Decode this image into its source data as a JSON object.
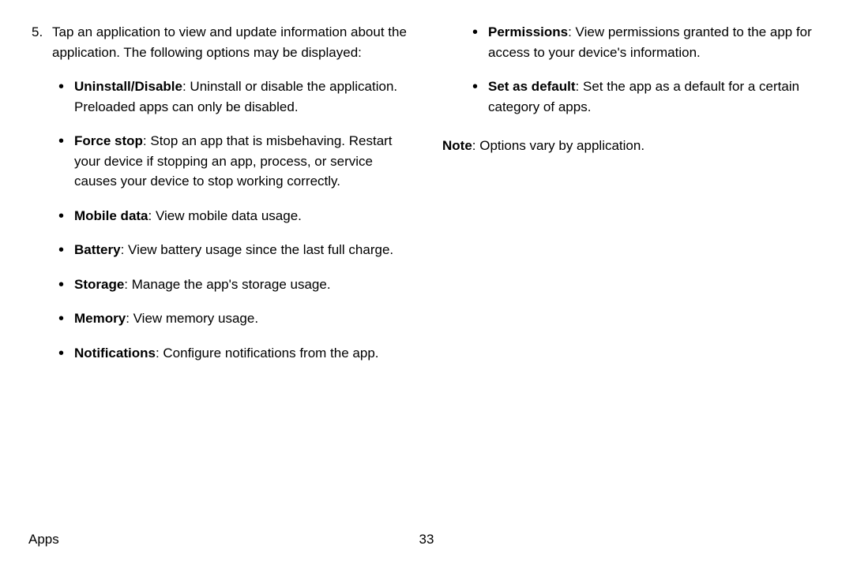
{
  "step": {
    "number": "5.",
    "text": "Tap an application to view and update information about the application. The following options may be displayed:"
  },
  "options_col1": [
    {
      "label": "Uninstall/Disable",
      "desc": ": Uninstall or disable the application. Preloaded apps can only be disabled."
    },
    {
      "label": "Force stop",
      "desc": ": Stop an app that is misbehaving. Restart your device if stopping an app, process, or service causes your device to stop working correctly."
    },
    {
      "label": "Mobile data",
      "desc": ": View mobile data usage."
    },
    {
      "label": "Battery",
      "desc": ": View battery usage since the last full charge."
    },
    {
      "label": "Storage",
      "desc": ": Manage the app's storage usage."
    },
    {
      "label": "Memory",
      "desc": ": View memory usage."
    },
    {
      "label": "Notifications",
      "desc": ": Configure notifications from the app."
    }
  ],
  "options_col2": [
    {
      "label": "Permissions",
      "desc": ": View permissions granted to the app for access to your device's information."
    },
    {
      "label": "Set as default",
      "desc": ": Set the app as a default for a certain category of apps."
    }
  ],
  "note": {
    "label": "Note",
    "text": ": Options vary by application."
  },
  "footer": {
    "section": "Apps",
    "page": "33"
  }
}
